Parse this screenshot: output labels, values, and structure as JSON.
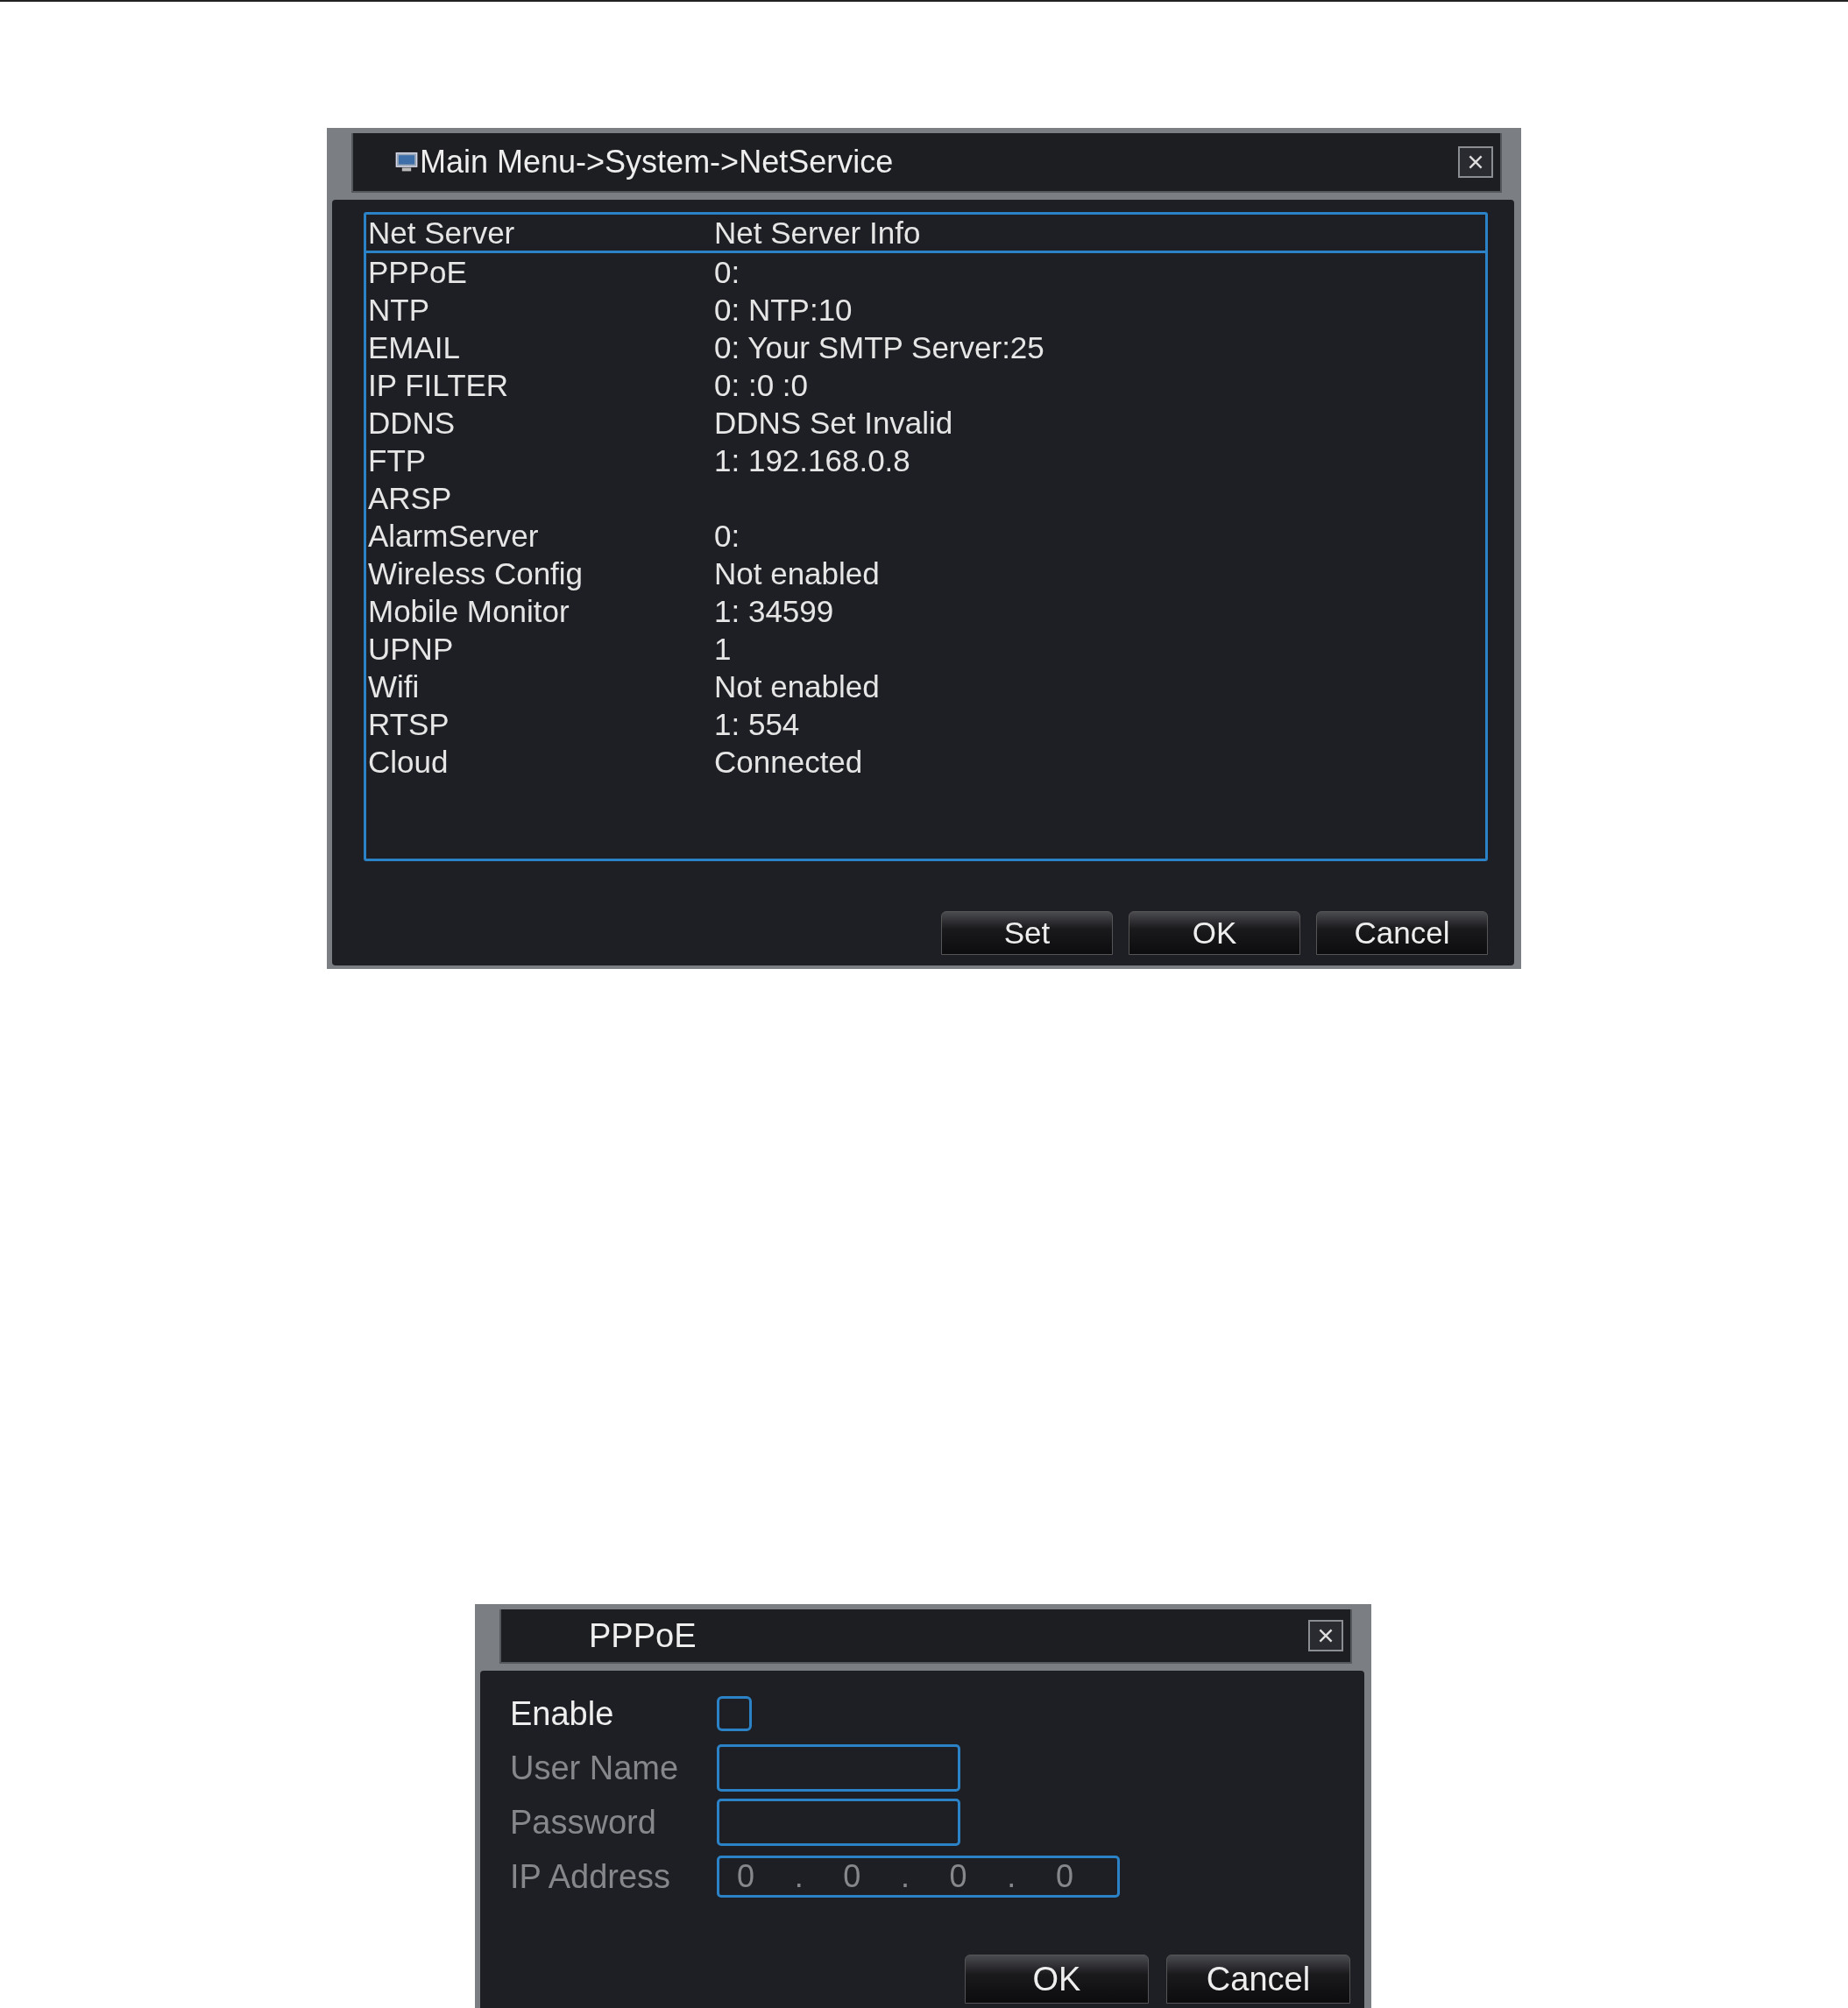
{
  "net_service_window": {
    "title": "Main Menu->System->NetService",
    "table": {
      "columns": [
        "Net Server",
        "Net Server Info"
      ],
      "rows": [
        {
          "server": "PPPoE",
          "info": "0:"
        },
        {
          "server": "NTP",
          "info": "0: NTP:10"
        },
        {
          "server": "EMAIL",
          "info": "0: Your SMTP Server:25"
        },
        {
          "server": "IP FILTER",
          "info": "0: :0 :0"
        },
        {
          "server": "DDNS",
          "info": "DDNS Set Invalid"
        },
        {
          "server": "FTP",
          "info": "1: 192.168.0.8"
        },
        {
          "server": "ARSP"
        },
        {
          "server": "AlarmServer",
          "info": "0:"
        },
        {
          "server": "Wireless Config",
          "info": "Not enabled"
        },
        {
          "server": "Mobile Monitor",
          "info": "1: 34599"
        },
        {
          "server": "UPNP",
          "info": "1"
        },
        {
          "server": "Wifi",
          "info": "Not enabled"
        },
        {
          "server": "RTSP",
          "info": "1: 554"
        },
        {
          "server": "Cloud",
          "info": "Connected"
        }
      ]
    },
    "buttons": [
      "Set",
      "OK",
      "Cancel"
    ]
  },
  "pppoe_window": {
    "title": "PPPoE",
    "fields": [
      {
        "kind": "checkbox",
        "label": "Enable",
        "checked": false,
        "disabled": false
      },
      {
        "kind": "text",
        "label": "User Name",
        "disabled": true
      },
      {
        "kind": "text",
        "label": "Password",
        "disabled": true
      },
      {
        "kind": "ip",
        "label": "IP Address",
        "disabled": true,
        "parts": [
          "0",
          ".",
          "0",
          ".",
          "0",
          ".",
          "0"
        ]
      }
    ],
    "buttons": [
      "OK",
      "Cancel"
    ]
  }
}
